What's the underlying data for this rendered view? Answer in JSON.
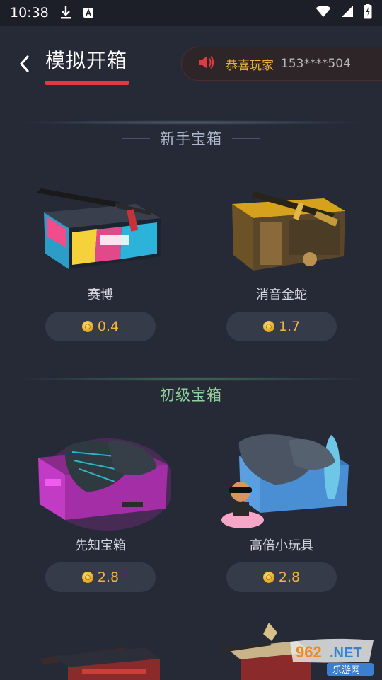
{
  "status_bar": {
    "time": "10:38"
  },
  "header": {
    "title": "模拟开箱",
    "notice_prefix": "恭喜玩家",
    "notice_player": "153****504"
  },
  "sections": [
    {
      "title": "新手宝箱",
      "crates": [
        {
          "name": "赛博",
          "price": "0.4"
        },
        {
          "name": "消音金蛇",
          "price": "1.7"
        }
      ]
    },
    {
      "title": "初级宝箱",
      "crates": [
        {
          "name": "先知宝箱",
          "price": "2.8"
        },
        {
          "name": "高倍小玩具",
          "price": "2.8"
        }
      ]
    }
  ],
  "watermark": {
    "brand": "962.NET",
    "sub": "乐游网"
  },
  "colors": {
    "accent": "#e23a3f",
    "price": "#f0b43c",
    "bg": "#262a37"
  }
}
